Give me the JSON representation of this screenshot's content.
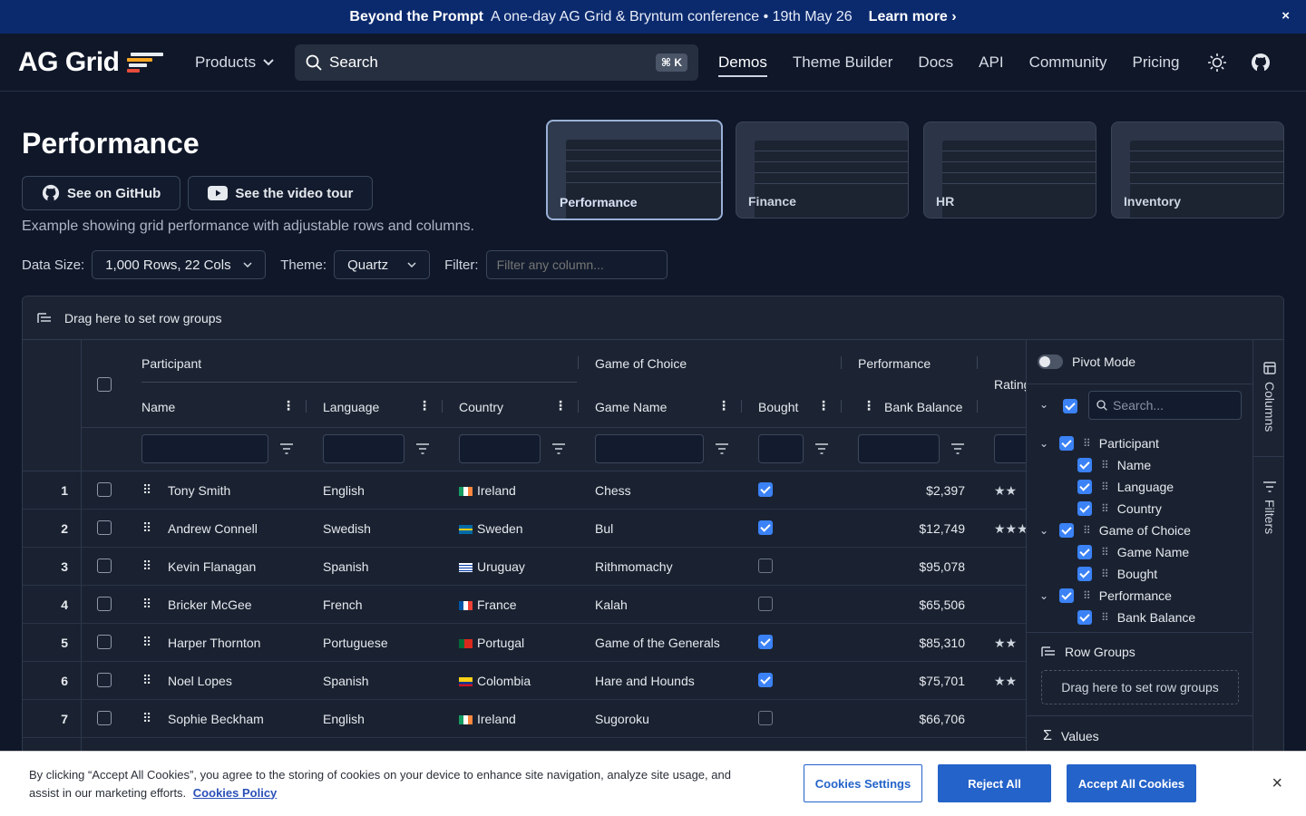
{
  "banner": {
    "bold": "Beyond the Prompt",
    "message": "A one-day AG Grid & Bryntum conference • 19th May 26",
    "link": "Learn more",
    "close": "×"
  },
  "nav": {
    "logo": "AG Grid",
    "products": "Products",
    "search_label": "Search",
    "search_kbd": "⌘ K",
    "links": [
      "Demos",
      "Theme Builder",
      "Docs",
      "API",
      "Community",
      "Pricing"
    ]
  },
  "page": {
    "title": "Performance",
    "github_btn": "See on GitHub",
    "video_btn": "See the video tour",
    "description": "Example showing grid performance with adjustable rows and columns.",
    "data_size_label": "Data Size:",
    "data_size_value": "1,000 Rows, 22 Cols",
    "theme_label": "Theme:",
    "theme_value": "Quartz",
    "filter_label": "Filter:",
    "filter_placeholder": "Filter any column..."
  },
  "thumbs": [
    "Performance",
    "Finance",
    "HR",
    "Inventory"
  ],
  "grid": {
    "rowgroup_hint": "Drag here to set row groups",
    "groups": {
      "participant": "Participant",
      "game": "Game of Choice",
      "performance": "Performance",
      "rating": "Rating"
    },
    "columns": {
      "name": "Name",
      "language": "Language",
      "country": "Country",
      "game_name": "Game Name",
      "bought": "Bought",
      "bank_balance": "Bank Balance"
    },
    "rows": [
      {
        "n": "1",
        "name": "Tony Smith",
        "language": "English",
        "country": "Ireland",
        "game": "Chess",
        "bought": true,
        "balance": "$2,397",
        "rating": "★★"
      },
      {
        "n": "2",
        "name": "Andrew Connell",
        "language": "Swedish",
        "country": "Sweden",
        "game": "Bul",
        "bought": true,
        "balance": "$12,749",
        "rating": "★★★"
      },
      {
        "n": "3",
        "name": "Kevin Flanagan",
        "language": "Spanish",
        "country": "Uruguay",
        "game": "Rithmomachy",
        "bought": false,
        "balance": "$95,078",
        "rating": ""
      },
      {
        "n": "4",
        "name": "Bricker McGee",
        "language": "French",
        "country": "France",
        "game": "Kalah",
        "bought": false,
        "balance": "$65,506",
        "rating": ""
      },
      {
        "n": "5",
        "name": "Harper Thornton",
        "language": "Portuguese",
        "country": "Portugal",
        "game": "Game of the Generals",
        "bought": true,
        "balance": "$85,310",
        "rating": "★★"
      },
      {
        "n": "6",
        "name": "Noel Lopes",
        "language": "Spanish",
        "country": "Colombia",
        "game": "Hare and Hounds",
        "bought": true,
        "balance": "$75,701",
        "rating": "★★"
      },
      {
        "n": "7",
        "name": "Sophie Beckham",
        "language": "English",
        "country": "Ireland",
        "game": "Sugoroku",
        "bought": false,
        "balance": "$66,706",
        "rating": ""
      }
    ]
  },
  "tool_panel": {
    "pivot_mode": "Pivot Mode",
    "search_placeholder": "Search...",
    "tree": {
      "participant": "Participant",
      "name": "Name",
      "language": "Language",
      "country": "Country",
      "game": "Game of Choice",
      "game_name": "Game Name",
      "bought": "Bought",
      "performance": "Performance",
      "bank_balance": "Bank Balance"
    },
    "row_groups": "Row Groups",
    "row_groups_drop": "Drag here to set row groups",
    "values": "Values",
    "tab_columns": "Columns",
    "tab_filters": "Filters"
  },
  "cookie": {
    "text": "By clicking “Accept All Cookies”, you agree to the storing of cookies on your device to enhance site navigation, analyze site usage, and assist in our marketing efforts.",
    "policy": "Cookies Policy",
    "settings": "Cookies Settings",
    "reject": "Reject All",
    "accept": "Accept All Cookies",
    "close": "×"
  },
  "colors": {
    "accent": "#3b82f6",
    "banner": "#0b2a6e",
    "background": "#0f1729",
    "cookie_button": "#2463c9"
  },
  "icons": [
    "chevron-right-icon",
    "close-icon",
    "chevron-down-icon",
    "search-icon",
    "sun-icon",
    "github-icon",
    "youtube-icon",
    "row-group-icon",
    "column-menu-icon",
    "filter-icon",
    "drag-handle-icon",
    "columns-icon",
    "filters-icon",
    "sigma-icon"
  ]
}
